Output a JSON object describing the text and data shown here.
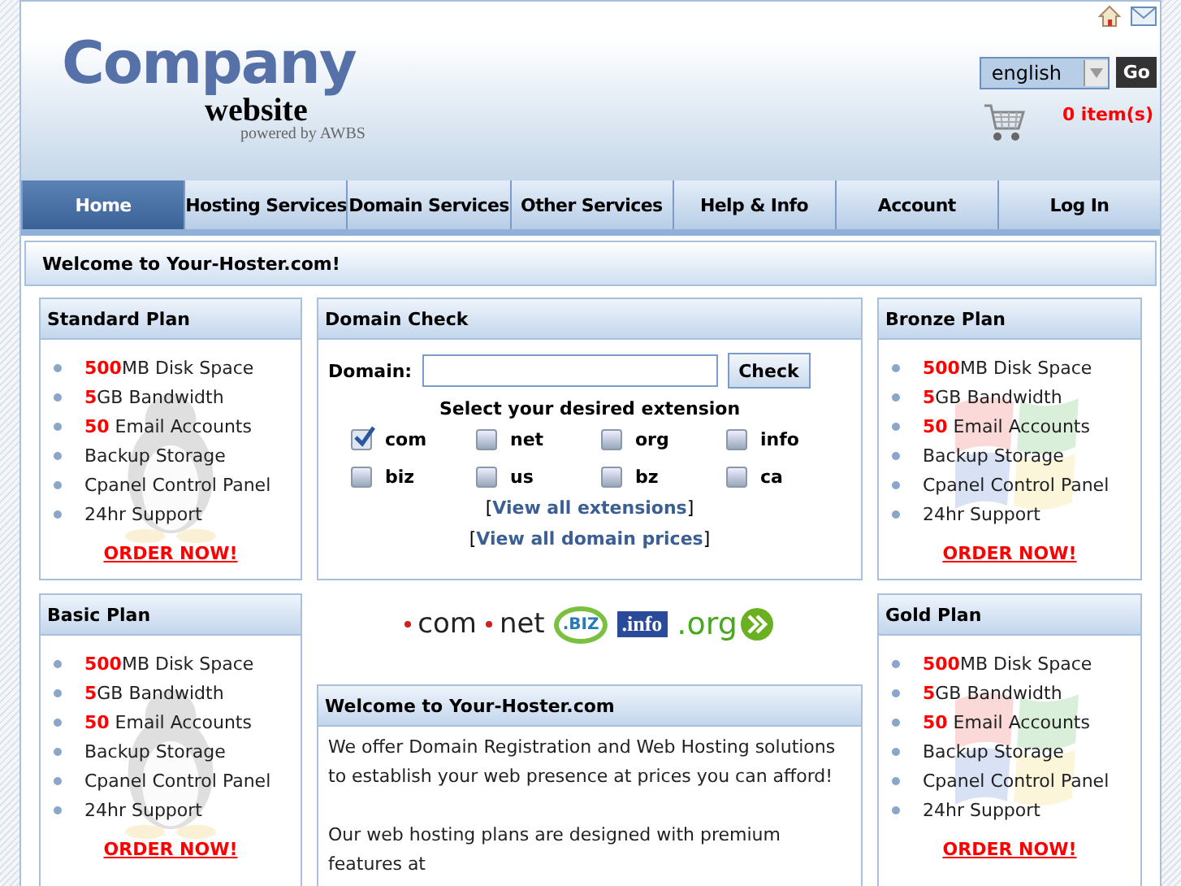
{
  "header": {
    "logo": {
      "name": "Company",
      "sub": "website",
      "powered": "powered by AWBS"
    },
    "language": {
      "value": "english",
      "button": "Go"
    },
    "cart": {
      "count": "0 item(s)"
    }
  },
  "nav": [
    {
      "label": "Home",
      "selected": true
    },
    {
      "label": "Hosting Services",
      "selected": false
    },
    {
      "label": "Domain Services",
      "selected": false
    },
    {
      "label": "Other Services",
      "selected": false
    },
    {
      "label": "Help & Info",
      "selected": false
    },
    {
      "label": "Account",
      "selected": false
    },
    {
      "label": "Log In",
      "selected": false
    }
  ],
  "welcome_bar": "Welcome to Your-Hoster.com!",
  "plans": [
    {
      "title": "Standard Plan",
      "kind": "linux",
      "features": [
        "**500**MB Disk Space",
        "**5**GB Bandwidth",
        "**50** Email Accounts",
        "Backup Storage",
        "Cpanel Control Panel",
        "24hr Support"
      ],
      "order": "ORDER NOW!"
    },
    {
      "title": "Bronze Plan",
      "kind": "windows",
      "features": [
        "**500**MB Disk Space",
        "**5**GB Bandwidth",
        "**50** Email Accounts",
        "Backup Storage",
        "Cpanel Control Panel",
        "24hr Support"
      ],
      "order": "ORDER NOW!"
    },
    {
      "title": "Basic Plan",
      "kind": "linux",
      "features": [
        "**500**MB Disk Space",
        "**5**GB Bandwidth",
        "**50** Email Accounts",
        "Backup Storage",
        "Cpanel Control Panel",
        "24hr Support"
      ],
      "order": "ORDER NOW!"
    },
    {
      "title": "Gold Plan",
      "kind": "windows",
      "features": [
        "**500**MB Disk Space",
        "**5**GB Bandwidth",
        "**50** Email Accounts",
        "Backup Storage",
        "Cpanel Control Panel",
        "24hr Support"
      ],
      "order": "ORDER NOW!"
    }
  ],
  "domain_check": {
    "title": "Domain Check",
    "label": "Domain:",
    "button": "Check",
    "prompt": "Select your desired extension",
    "extensions": [
      {
        "label": "com",
        "checked": true
      },
      {
        "label": "net",
        "checked": false
      },
      {
        "label": "org",
        "checked": false
      },
      {
        "label": "info",
        "checked": false
      },
      {
        "label": "biz",
        "checked": false
      },
      {
        "label": "us",
        "checked": false
      },
      {
        "label": "bz",
        "checked": false
      },
      {
        "label": "ca",
        "checked": false
      }
    ],
    "links": [
      {
        "open": "[",
        "label": "View all extensions",
        "close": "]"
      },
      {
        "open": "[",
        "label": "View all domain prices",
        "close": "]"
      }
    ]
  },
  "tld_logos": [
    {
      "kind": "dot",
      "label": "com"
    },
    {
      "kind": "dot",
      "label": "net"
    },
    {
      "kind": "ring",
      "label": ".BIZ"
    },
    {
      "kind": "block",
      "label": ".info"
    },
    {
      "kind": "arrow",
      "label": ".org"
    }
  ],
  "intro": {
    "title": "Welcome to Your-Hoster.com",
    "paragraphs": [
      "We offer Domain Registration and Web Hosting solutions to establish your web presence at prices you can afford!",
      "Our web hosting plans are designed with premium features at"
    ]
  }
}
